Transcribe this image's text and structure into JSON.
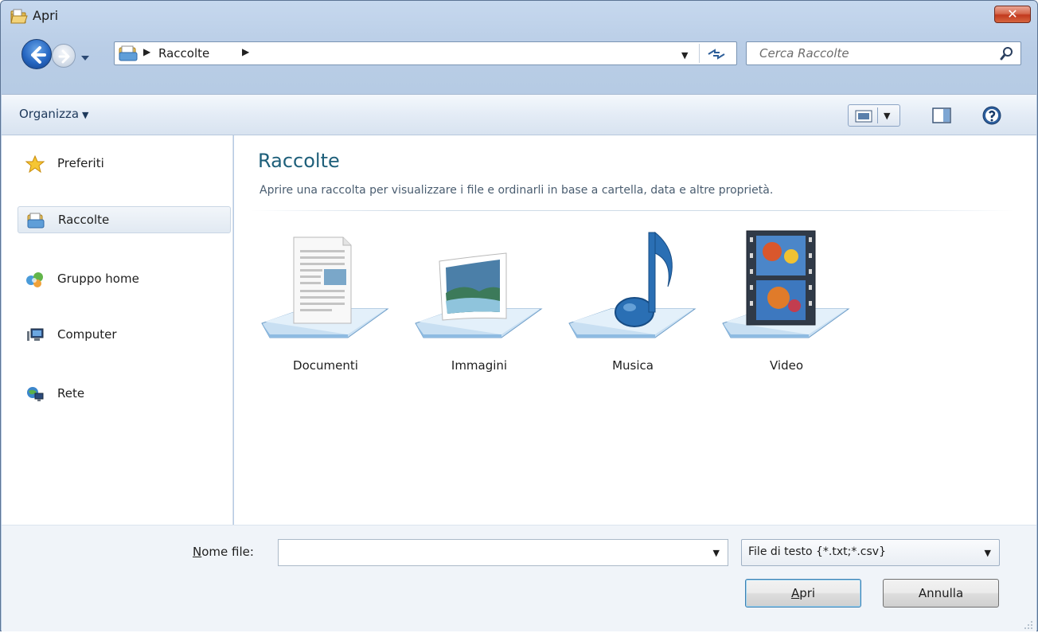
{
  "window": {
    "title": "Apri",
    "close_label": "✕"
  },
  "address": {
    "crumb": "Raccolte",
    "sep_glyph": "▶",
    "dropdown_glyph": "▼"
  },
  "search": {
    "placeholder": "Cerca Raccolte"
  },
  "toolbar": {
    "organize_label": "Organizza",
    "organize_caret": "▼",
    "view_dropdown_glyph": "▼"
  },
  "navigation": {
    "items": [
      {
        "label": "Preferiti",
        "icon": "star-icon",
        "selected": false
      },
      {
        "label": "Raccolte",
        "icon": "libraries-icon",
        "selected": true
      },
      {
        "label": "Gruppo home",
        "icon": "homegroup-icon",
        "selected": false
      },
      {
        "label": "Computer",
        "icon": "computer-icon",
        "selected": false
      },
      {
        "label": "Rete",
        "icon": "network-icon",
        "selected": false
      }
    ]
  },
  "content": {
    "title": "Raccolte",
    "subtitle": "Aprire una raccolta per visualizzare i file e ordinarli in base a cartella, data e altre proprietà.",
    "libraries": [
      {
        "label": "Documenti",
        "icon": "documents-library-icon"
      },
      {
        "label": "Immagini",
        "icon": "pictures-library-icon"
      },
      {
        "label": "Musica",
        "icon": "music-library-icon"
      },
      {
        "label": "Video",
        "icon": "videos-library-icon"
      }
    ]
  },
  "footer": {
    "filename_label_accel": "N",
    "filename_label_rest": "ome file:",
    "filename_value": "",
    "filename_dropdown_glyph": "▼",
    "filetype_value": "File di testo {*.txt;*.csv}",
    "filetype_dropdown_glyph": "▼",
    "open_accel": "A",
    "open_rest": "pri",
    "cancel_label": "Annulla"
  }
}
